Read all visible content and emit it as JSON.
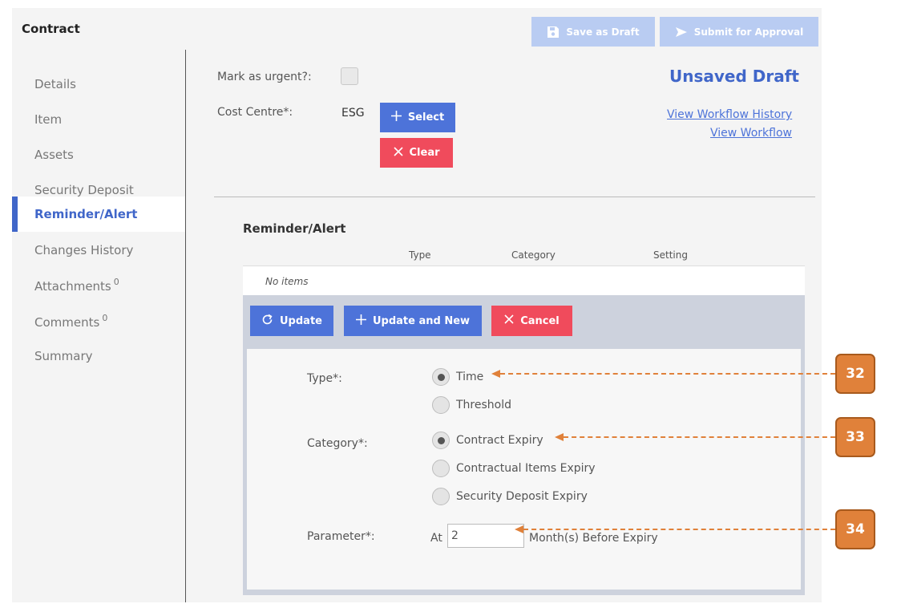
{
  "header": {
    "title": "Contract",
    "save_draft_label": "Save as Draft",
    "submit_label": "Submit for Approval"
  },
  "sidebar": {
    "items": [
      {
        "label": "Details",
        "badge": ""
      },
      {
        "label": "Item",
        "badge": ""
      },
      {
        "label": "Assets",
        "badge": ""
      },
      {
        "label": "Security Deposit",
        "badge": ""
      },
      {
        "label": "Reminder/Alert",
        "badge": ""
      },
      {
        "label": "Changes History",
        "badge": ""
      },
      {
        "label": "Attachments",
        "badge": "0"
      },
      {
        "label": "Comments",
        "badge": "0"
      },
      {
        "label": "Summary",
        "badge": ""
      }
    ],
    "active_index": 4
  },
  "main": {
    "urgent_label": "Mark as urgent?:",
    "cost_centre_label": "Cost Centre*:",
    "cost_centre_value": "ESG",
    "select_label": "Select",
    "clear_label": "Clear",
    "status": "Unsaved Draft",
    "view_history_link": "View Workflow History",
    "view_workflow_link": "View Workflow"
  },
  "reminder": {
    "title": "Reminder/Alert",
    "columns": [
      "Type",
      "Category",
      "Setting"
    ],
    "empty_text": "No items",
    "update_label": "Update",
    "update_new_label": "Update and New",
    "cancel_label": "Cancel",
    "type_label": "Type*:",
    "type_options": [
      "Time",
      "Threshold"
    ],
    "type_selected": 0,
    "category_label": "Category*:",
    "category_options": [
      "Contract Expiry",
      "Contractual Items Expiry",
      "Security Deposit Expiry"
    ],
    "category_selected": 0,
    "parameter_label": "Parameter*:",
    "parameter_prefix": "At",
    "parameter_value": "2",
    "parameter_suffix": "Month(s) Before Expiry"
  },
  "callouts": [
    "32",
    "33",
    "34"
  ],
  "colors": {
    "accent": "#4066c9",
    "button_blue": "#4d73d9",
    "button_red": "#f04b5c",
    "callout": "#e0813a",
    "header_button_disabled": "#b9ccf2"
  }
}
